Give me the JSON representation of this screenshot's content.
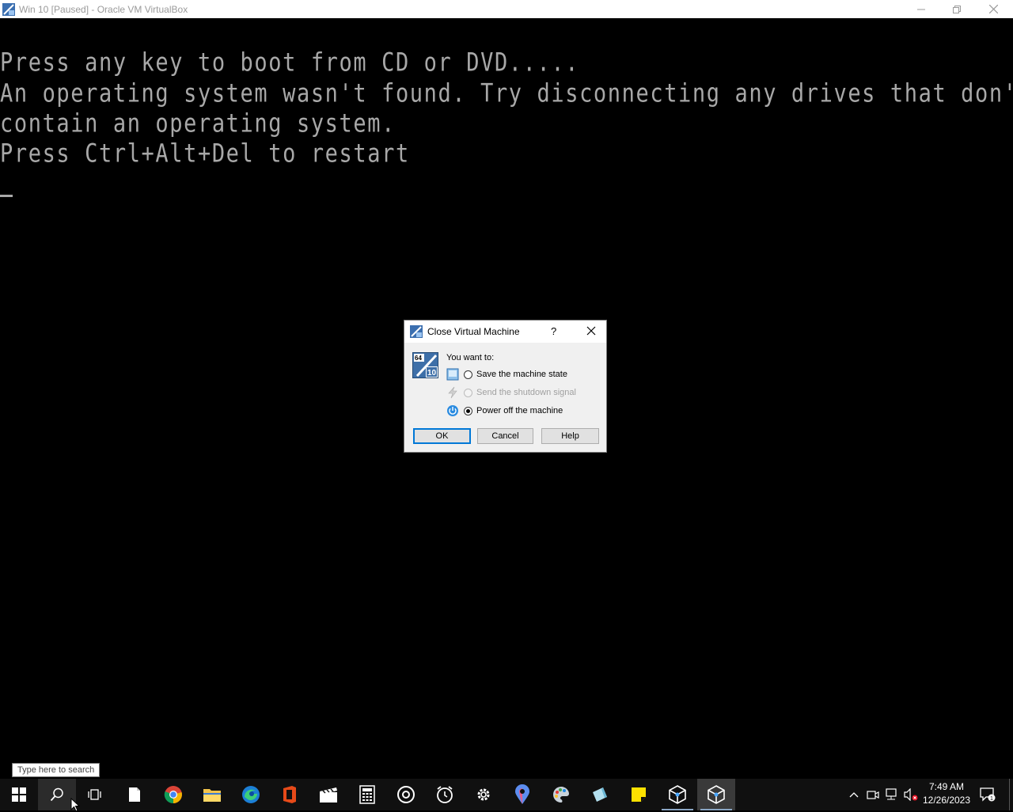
{
  "window": {
    "title": "Win 10 [Paused] - Oracle VM VirtualBox"
  },
  "console": {
    "lines": [
      "Press any key to boot from CD or DVD.....",
      "An operating system wasn't found. Try disconnecting any drives that don't",
      "contain an operating system.",
      "Press Ctrl+Alt+Del to restart"
    ],
    "text_color": "#a8a8a8"
  },
  "dialog": {
    "title": "Close Virtual Machine",
    "help_glyph": "?",
    "prompt": "You want to:",
    "options": [
      {
        "label": "Save the machine state",
        "selected": false,
        "enabled": true
      },
      {
        "label": "Send the shutdown signal",
        "selected": false,
        "enabled": false
      },
      {
        "label": "Power off the machine",
        "selected": true,
        "enabled": true
      }
    ],
    "buttons": {
      "ok": "OK",
      "cancel": "Cancel",
      "help": "Help"
    },
    "badge": {
      "top": "64",
      "bottom": "10"
    }
  },
  "tooltip": {
    "text": "Type here to search"
  },
  "taskbar": {
    "items": [
      {
        "name": "start",
        "icon": "windows-logo-icon"
      },
      {
        "name": "search",
        "icon": "search-icon"
      },
      {
        "name": "task-view",
        "icon": "task-view-icon"
      },
      {
        "name": "notepad",
        "icon": "document-icon"
      },
      {
        "name": "chrome",
        "icon": "chrome-icon"
      },
      {
        "name": "file-explorer",
        "icon": "folder-icon"
      },
      {
        "name": "edge",
        "icon": "edge-icon"
      },
      {
        "name": "office",
        "icon": "office-icon"
      },
      {
        "name": "video-editor",
        "icon": "clapperboard-icon"
      },
      {
        "name": "calculator",
        "icon": "calculator-icon"
      },
      {
        "name": "groove",
        "icon": "music-disc-icon"
      },
      {
        "name": "alarms",
        "icon": "alarm-clock-icon"
      },
      {
        "name": "settings",
        "icon": "gear-icon"
      },
      {
        "name": "maps",
        "icon": "map-pin-icon"
      },
      {
        "name": "paint",
        "icon": "palette-icon"
      },
      {
        "name": "paint3d",
        "icon": "crystal-icon"
      },
      {
        "name": "sticky-notes",
        "icon": "sticky-note-icon"
      },
      {
        "name": "virtualbox-manager",
        "icon": "virtualbox-icon"
      },
      {
        "name": "virtualbox-vm",
        "icon": "virtualbox-icon"
      }
    ],
    "clock": {
      "time": "7:49 AM",
      "date": "12/26/2023"
    },
    "notification_count": "1"
  },
  "colors": {
    "accent": "#0078d7",
    "taskbar": "#101010"
  }
}
